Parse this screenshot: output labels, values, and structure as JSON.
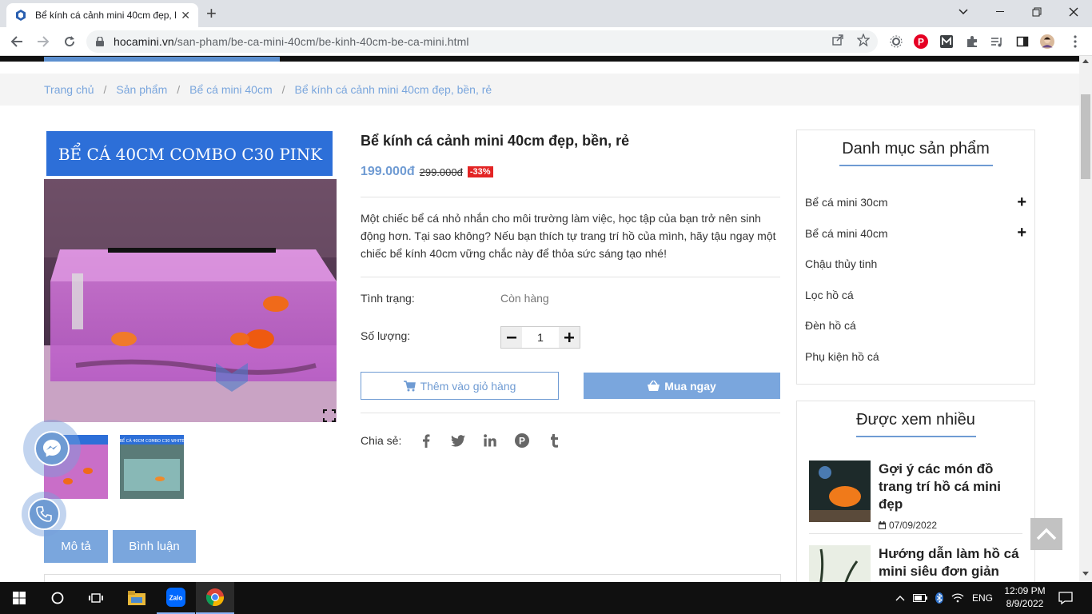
{
  "browser": {
    "tab_title": "Bể kính cá cảnh mini 40cm đẹp, b",
    "url_domain": "hocamini.vn",
    "url_path": "/san-pham/be-ca-mini-40cm/be-kinh-40cm-be-ca-mini.html"
  },
  "breadcrumb": {
    "items": [
      "Trang chủ",
      "Sản phẩm",
      "Bể cá mini 40cm",
      "Bể kính cá cảnh mini 40cm đẹp, bền, rẻ"
    ],
    "separator": "/"
  },
  "product": {
    "image_banner": "BỂ CÁ 40CM COMBO C30 PINK",
    "thumb2_banner": "BỂ CÁ 40CM COMBO C30 WHITE",
    "title": "Bể kính cá cảnh mini 40cm đẹp, bền, rẻ",
    "price": "199.000đ",
    "old_price": "299.000đ",
    "discount": "-33%",
    "description": "Một chiếc bể cá nhỏ nhắn cho môi trường làm việc, học tập của bạn trở nên sinh động hơn. Tại sao không? Nếu bạn thích tự trang trí hồ của mình, hãy tậu ngay một chiếc bể kính 40cm vững chắc này để thỏa sức sáng tạo nhé!",
    "status_label": "Tình trạng:",
    "status_value": "Còn hàng",
    "qty_label": "Số lượng:",
    "qty_value": "1",
    "add_to_cart": "Thêm vào giỏ hàng",
    "buy_now": "Mua ngay",
    "share_label": "Chia sẻ:"
  },
  "tabs": [
    "Mô tả",
    "Bình luận"
  ],
  "sidebar": {
    "categories_title": "Danh mục sản phẩm",
    "categories": [
      {
        "label": "Bể cá mini 30cm",
        "expandable": true
      },
      {
        "label": "Bể cá mini 40cm",
        "expandable": true
      },
      {
        "label": "Chậu thủy tinh",
        "expandable": false
      },
      {
        "label": "Lọc hồ cá",
        "expandable": false
      },
      {
        "label": "Đèn hồ cá",
        "expandable": false
      },
      {
        "label": "Phụ kiện hồ cá",
        "expandable": false
      }
    ],
    "popular_title": "Được xem nhiều",
    "posts": [
      {
        "title": "Gợi ý các món đồ trang trí hồ cá mini đẹp",
        "date": "07/09/2022"
      },
      {
        "title": "Hướng dẫn làm hồ cá mini siêu đơn giản",
        "date": ""
      }
    ]
  },
  "taskbar": {
    "lang": "ENG",
    "time": "12:09 PM",
    "date": "8/9/2022"
  },
  "colors": {
    "accent": "#6f9bd3",
    "discount": "#e32424"
  }
}
